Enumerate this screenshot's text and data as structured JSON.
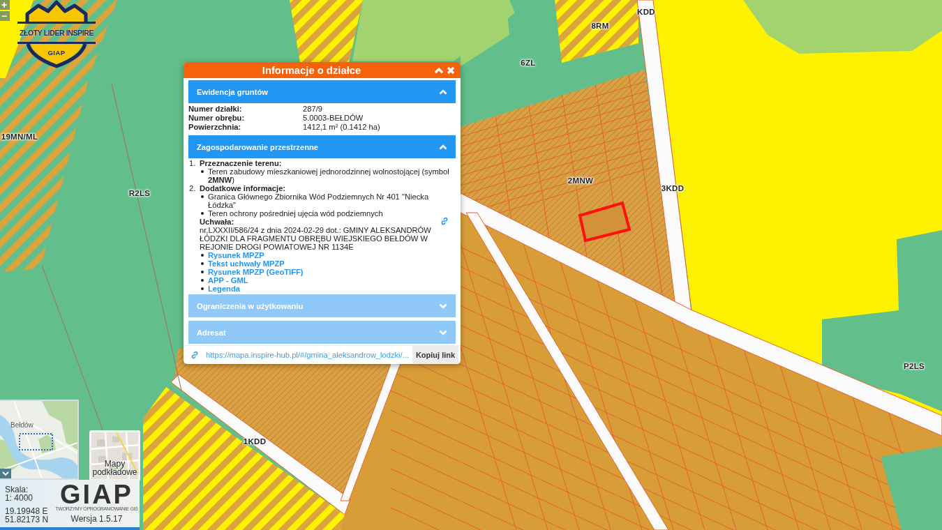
{
  "zoom_buttons": [
    "+",
    "−"
  ],
  "logo": {
    "title": "ZŁOTY LIDER INSPIRE",
    "badge": "GIAP"
  },
  "map": {
    "zone_labels": [
      "KDD",
      "8RM",
      "6ZL",
      "19MN/ML",
      "R2LS",
      "2MNW",
      "3KDD",
      "P2LS",
      "1KDD"
    ]
  },
  "parcel_popup": {
    "title": "Informacje o działce",
    "sections": [
      {
        "title": "Ewidencja gruntów",
        "expanded": true,
        "kind": "fields",
        "fields": [
          {
            "label": "Numer działki:",
            "value": "287/9"
          },
          {
            "label": "Numer obrębu:",
            "value": "5.0003-BEŁDÓW"
          },
          {
            "label": "Powierzchnia:",
            "value": "1412,1 m² (0.1412 ha)"
          }
        ]
      },
      {
        "title": "Zagospodarowanie przestrzenne",
        "expanded": true,
        "kind": "plan",
        "items": [
          {
            "number": "1.",
            "heading": "Przeznaczenie terenu:",
            "bullets": [
              "Teren zabudowy mieszkaniowej jednorodzinnej wolnostojącej (symbol **2MNW**)"
            ]
          },
          {
            "number": "2.",
            "heading": "Dodatkowe informacje:",
            "bullets": [
              "Granica Głównego Zbiornika Wód Podziemnych Nr 401 \"Niecka Łódzka\"",
              "Teren ochrony pośredniej ujęcia wód podziemnych"
            ]
          }
        ],
        "resolution": {
          "heading": "Uchwała:",
          "text": "nr,LXXXII/586/24 z dnia 2024-02-29 dot.: GMINY ALEKSANDRÓW ŁÓDZKI DLA FRAGMENTU OBRĘBU WIEJSKIEGO BEŁDÓW W REJONIE DROGI POWIATOWEJ NR 1134E",
          "links": [
            "Rysunek MPZP",
            "Tekst uchwały MPZP",
            "Rysunek MPZP (GeoTIFF)",
            "APP - GML",
            "Legenda"
          ]
        }
      },
      {
        "title": "Ograniczenia w użytkowaniu",
        "expanded": false
      },
      {
        "title": "Adresat",
        "expanded": false
      }
    ],
    "share_url": "https://mapa.inspire-hub.pl/#/gmina_aleksandrow_lodzki/...",
    "copy_button": "Kopiuj link"
  },
  "minimap": {
    "place_label": "Bełdów"
  },
  "basemap_button": "Mapy podkładowe",
  "status_panel": {
    "scale_label": "Skala:",
    "scale": "1: 4000",
    "coordinates": [
      "19.19948 E",
      "51.82173 N"
    ],
    "brand": "GIAP",
    "tagline": "TWORZYMY OPROGRAMOWANIE GIS",
    "version": "Wersja 1.5.17"
  }
}
